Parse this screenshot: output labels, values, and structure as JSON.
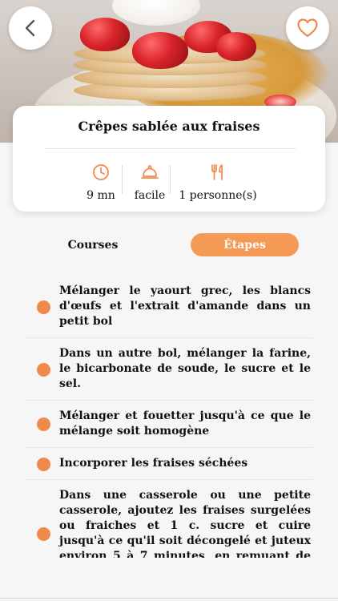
{
  "recipe": {
    "title": "Crêpes sablée aux fraises",
    "time": "9 mn",
    "difficulty": "facile",
    "servings": "1 personne(s)"
  },
  "tabs": [
    {
      "label": "Courses",
      "active": false
    },
    {
      "label": "Étapes",
      "active": true
    }
  ],
  "steps": [
    {
      "text": "Mélanger le yaourt grec, les blancs d'œufs et l'extrait d'amande dans un petit bol"
    },
    {
      "text": "Dans un autre bol, mélanger la farine, le bicarbonate de soude, le sucre et le sel."
    },
    {
      "text": "Mélanger et fouetter jusqu'à ce que le mélange soit homogène"
    },
    {
      "text": "Incorporer les fraises séchées"
    },
    {
      "text": "Dans une casserole ou une petite casserole, ajoutez les fraises surgelées ou fraiches et 1 c. sucre et cuire jusqu'à ce qu'il soit décongelé et juteux environ 5 à 7 minutes, en remuant de temps en temps"
    }
  ],
  "colors": {
    "accent": "#f59a55",
    "bullet": "#f08a4b"
  },
  "icons": {
    "back": "chevron-left-icon",
    "favorite": "heart-outline-icon",
    "time": "clock-icon",
    "difficulty": "cloche-icon",
    "servings": "fork-knife-icon"
  }
}
